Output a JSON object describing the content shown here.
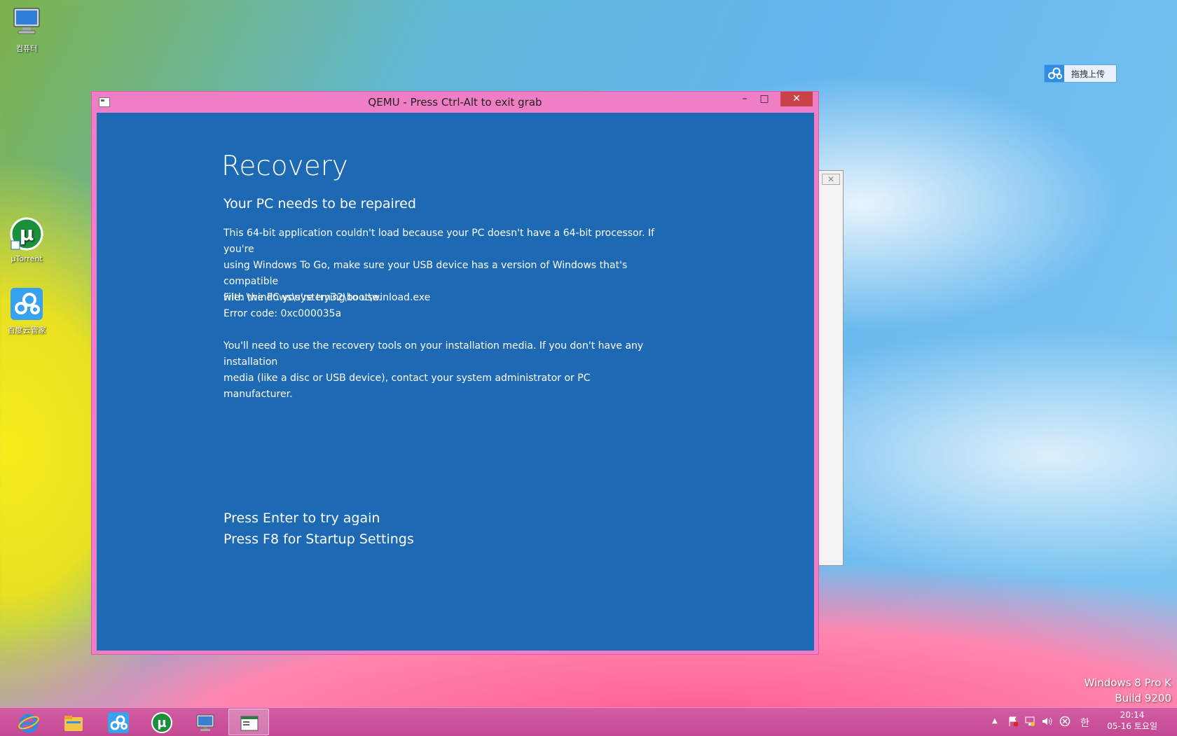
{
  "desktop": {
    "icons": [
      {
        "label": "컴퓨터"
      },
      {
        "label": "μTorrent"
      },
      {
        "label": "百度云管家"
      }
    ],
    "watermark": {
      "line1": "Windows 8 Pro K",
      "line2": "Build 9200"
    },
    "cloud_upload_button": {
      "label": "拖拽上传"
    }
  },
  "qemu_window": {
    "title": "QEMU - Press Ctrl-Alt to exit grab",
    "controls": {
      "minimize": "–",
      "maximize": "□",
      "close": "✕"
    }
  },
  "recovery": {
    "title": "Recovery",
    "subtitle": "Your PC needs to be repaired",
    "paragraph1_line1": "This 64-bit application couldn't load because your PC doesn't have a 64-bit processor. If you're",
    "paragraph1_line2": "using Windows To Go, make sure your USB device has a version of Windows that's compatible",
    "paragraph1_line3": "with the PC you're trying to use.",
    "file": "File: \\windows\\system32\\boot\\winload.exe",
    "error_code": "Error code: 0xc000035a",
    "paragraph2_line1": "You'll need to use the recovery tools on your installation media. If you don't have any installation",
    "paragraph2_line2": "media (like a disc or USB device), contact your system administrator or PC manufacturer.",
    "option_enter": "Press Enter to try again",
    "option_f8": "Press F8 for Startup Settings"
  },
  "background_window": {
    "close": "✕"
  },
  "taskbar": {
    "ime": "한",
    "clock_time": "20:14",
    "clock_date": "05-16 토요일"
  },
  "colors": {
    "recovery_blue": "#1e69b4",
    "window_frame": "#f07ec6",
    "taskbar": "#c94b96",
    "close_button": "#c94249"
  }
}
